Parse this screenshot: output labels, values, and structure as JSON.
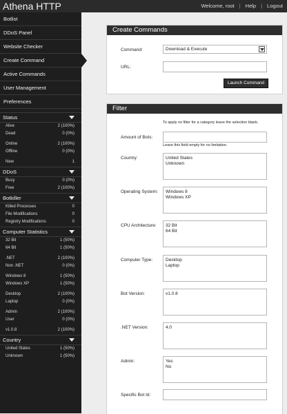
{
  "app": {
    "title": "Athena HTTP"
  },
  "topnav": {
    "welcome": "Welcome, root",
    "help": "Help",
    "logout": "Logout"
  },
  "sidebar": {
    "nav": [
      "Botlist",
      "DDoS Panel",
      "Website Checker",
      "Create Command",
      "Active Commands",
      "User Management",
      "Preferences"
    ],
    "status": {
      "title": "Status",
      "rows": [
        [
          "Alive",
          "2 (100%)"
        ],
        [
          "Dead",
          "0 (0%)"
        ],
        [
          "Online",
          "2 (100%)"
        ],
        [
          "Offline",
          "0 (0%)"
        ],
        [
          "New",
          "1"
        ]
      ]
    },
    "ddos": {
      "title": "DDoS",
      "rows": [
        [
          "Busy",
          "0 (0%)"
        ],
        [
          "Free",
          "2 (100%)"
        ]
      ]
    },
    "botkiller": {
      "title": "Botkiller",
      "rows": [
        [
          "Killed Processes",
          "0"
        ],
        [
          "File Modifications",
          "0"
        ],
        [
          "Registry Modifications",
          "0"
        ]
      ]
    },
    "computer": {
      "title": "Computer Statistics",
      "rows": [
        [
          "32 Bit",
          "1 (50%)"
        ],
        [
          "64 Bit",
          "1 (50%)"
        ],
        [
          ".NET",
          "2 (100%)"
        ],
        [
          "Non .NET",
          "0 (0%)"
        ],
        [
          "Windows 8",
          "1 (50%)"
        ],
        [
          "Windows XP",
          "1 (50%)"
        ],
        [
          "Desktop",
          "2 (100%)"
        ],
        [
          "Laptop",
          "0 (0%)"
        ],
        [
          "Admin",
          "2 (100%)"
        ],
        [
          "User",
          "0 (0%)"
        ],
        [
          "v1.0.8",
          "2 (100%)"
        ]
      ]
    },
    "country": {
      "title": "Country",
      "rows": [
        [
          "United States",
          "1 (50%)"
        ],
        [
          "Unknown",
          "1 (50%)"
        ]
      ]
    }
  },
  "create": {
    "title": "Create Commands",
    "command_label": "Command:",
    "command_value": "Download & Execute",
    "url_label": "URL:",
    "url_value": "",
    "launch": "Launch Command"
  },
  "filter": {
    "title": "Filter",
    "note": "To apply no filter for a category leave the selection blank.",
    "amount_label": "Amount of Bots:",
    "amount_hint": "Leave this field empty for no limitation.",
    "country_label": "Country:",
    "country_opts": [
      "United States",
      "Unknown"
    ],
    "os_label": "Operating System:",
    "os_opts": [
      "Windows 8",
      "Windows XP"
    ],
    "cpu_label": "CPU Architecture:",
    "cpu_opts": [
      "32 Bit",
      "64 Bit"
    ],
    "type_label": "Computer Type:",
    "type_opts": [
      "Desktop",
      "Laptop"
    ],
    "ver_label": "Bot Version:",
    "ver_opts": [
      "v1.0.8"
    ],
    "net_label": ".NET Version:",
    "net_opts": [
      "4.0"
    ],
    "admin_label": "Admin:",
    "admin_opts": [
      "Yes",
      "No"
    ],
    "botid_label": "Specific Bot Id:"
  }
}
